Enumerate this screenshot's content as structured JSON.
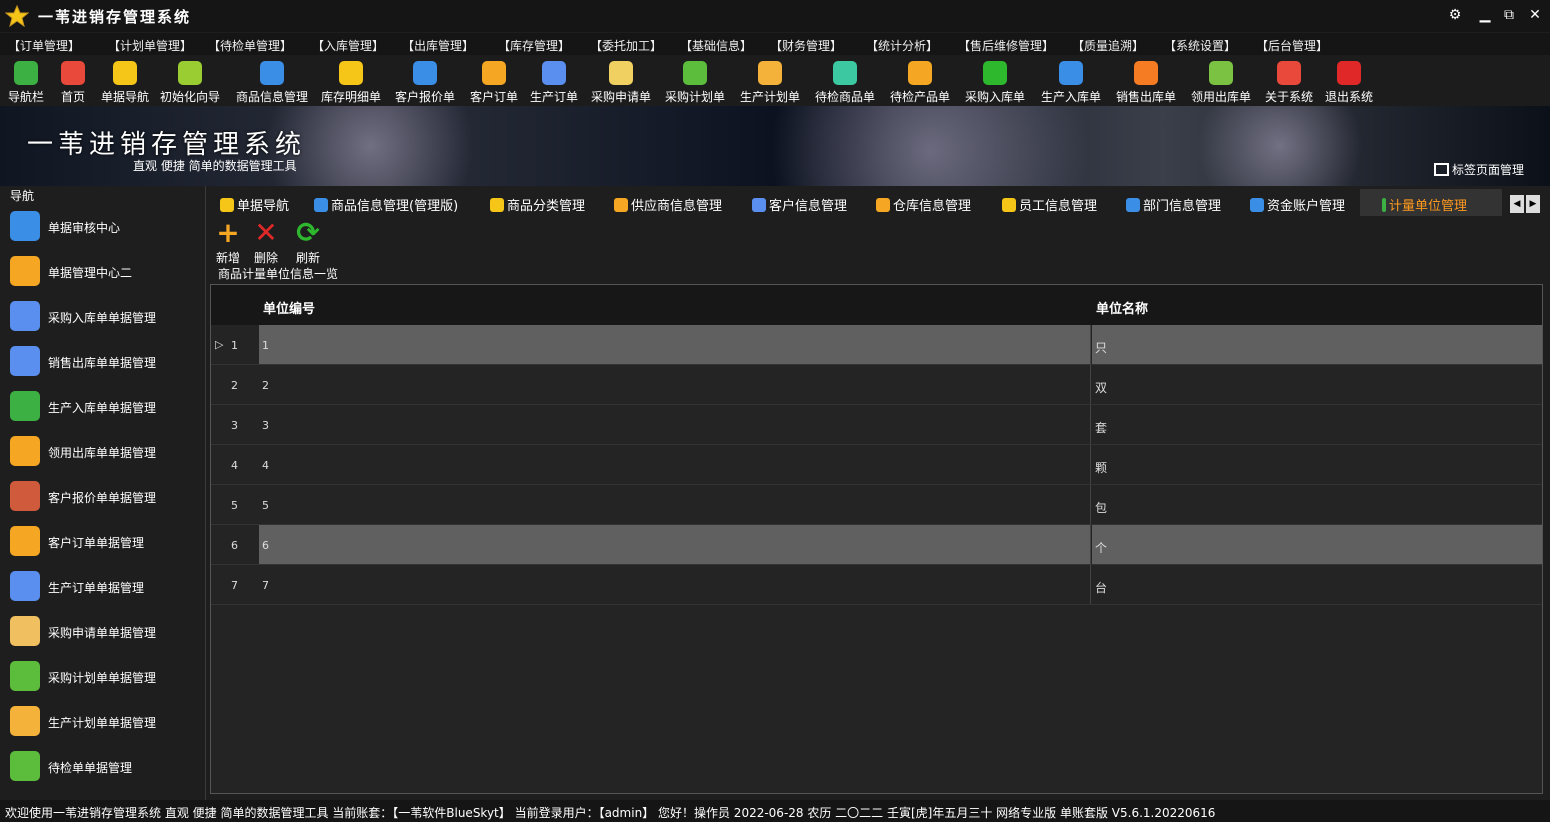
{
  "app": {
    "title": "一苇进销存管理系统"
  },
  "menu": [
    "【订单管理】",
    "【计划单管理】",
    "【待检单管理】",
    "【入库管理】",
    "【出库管理】",
    "【库存管理】",
    "【委托加工】",
    "【基础信息】",
    "【财务管理】",
    "【统计分析】",
    "【售后维修管理】",
    "【质量追溯】",
    "【系统设置】",
    "【后台管理】"
  ],
  "toolbar": [
    {
      "label": "导航栏",
      "icon": "menu-icon",
      "color": "#3cb043"
    },
    {
      "label": "首页",
      "icon": "home-icon",
      "color": "#e8493a"
    },
    {
      "label": "单据导航",
      "icon": "pin-icon",
      "color": "#f5c518"
    },
    {
      "label": "初始化向导",
      "icon": "wand-icon",
      "color": "#9acd32"
    },
    {
      "label": "商品信息管理",
      "icon": "cubes-icon",
      "color": "#3a8ee6"
    },
    {
      "label": "库存明细单",
      "icon": "warning-icon",
      "color": "#f5c518"
    },
    {
      "label": "客户报价单",
      "icon": "tag-icon",
      "color": "#3a8ee6"
    },
    {
      "label": "客户订单",
      "icon": "doc-icon",
      "color": "#f5a623"
    },
    {
      "label": "生产订单",
      "icon": "doc-icon",
      "color": "#5a8ff0"
    },
    {
      "label": "采购申请单",
      "icon": "notepad-icon",
      "color": "#f0d060"
    },
    {
      "label": "采购计划单",
      "icon": "chat-icon",
      "color": "#5cbc3c"
    },
    {
      "label": "生产计划单",
      "icon": "chat-icon",
      "color": "#f5b23a"
    },
    {
      "label": "待检商品单",
      "icon": "flask-icon",
      "color": "#3cc8a0"
    },
    {
      "label": "待检产品单",
      "icon": "beaker-icon",
      "color": "#f5a623"
    },
    {
      "label": "采购入库单",
      "icon": "plus-circle-icon",
      "color": "#2eb82e"
    },
    {
      "label": "生产入库单",
      "icon": "trolley-icon",
      "color": "#3a8ee6"
    },
    {
      "label": "销售出库单",
      "icon": "export-icon",
      "color": "#f57c23"
    },
    {
      "label": "领用出库单",
      "icon": "download-icon",
      "color": "#7cc242"
    },
    {
      "label": "关于系统",
      "icon": "house-icon",
      "color": "#e8493a"
    },
    {
      "label": "退出系统",
      "icon": "exit-icon",
      "color": "#e02828"
    }
  ],
  "banner": {
    "title": "一苇进销存管理系统",
    "subtitle": "直观  便捷  简单的数据管理工具",
    "tab_manager": "标签页面管理"
  },
  "sidebar": {
    "title": "导航",
    "items": [
      {
        "label": "单据审核中心",
        "icon": "grid-icon",
        "color": "#3a8ee6"
      },
      {
        "label": "单据管理中心二",
        "icon": "grid-diamond-icon",
        "color": "#f5a623"
      },
      {
        "label": "采购入库单单据管理",
        "icon": "arrow-left-icon",
        "color": "#5a8ff0"
      },
      {
        "label": "销售出库单单据管理",
        "icon": "arrow-right-icon",
        "color": "#5a8ff0"
      },
      {
        "label": "生产入库单单据管理",
        "icon": "box-icon",
        "color": "#3cb043"
      },
      {
        "label": "领用出库单单据管理",
        "icon": "building-icon",
        "color": "#f5a623"
      },
      {
        "label": "客户报价单单据管理",
        "icon": "books-icon",
        "color": "#d05a3c"
      },
      {
        "label": "客户订单单据管理",
        "icon": "doc-icon",
        "color": "#f5a623"
      },
      {
        "label": "生产订单单据管理",
        "icon": "doc-icon",
        "color": "#5a8ff0"
      },
      {
        "label": "采购申请单单据管理",
        "icon": "envelope-icon",
        "color": "#f0c060"
      },
      {
        "label": "采购计划单单据管理",
        "icon": "chat-icon",
        "color": "#5cbc3c"
      },
      {
        "label": "生产计划单单据管理",
        "icon": "chat-icon",
        "color": "#f5b23a"
      },
      {
        "label": "待检单单据管理",
        "icon": "clipboard-icon",
        "color": "#5cbc3c"
      }
    ]
  },
  "tabs": [
    {
      "label": "单据导航",
      "icon": "pin-icon",
      "color": "#f5c518",
      "active": false
    },
    {
      "label": "商品信息管理(管理版)",
      "icon": "cubes-icon",
      "color": "#3a8ee6",
      "active": false
    },
    {
      "label": "商品分类管理",
      "icon": "tag-icon",
      "color": "#f5c518",
      "active": false
    },
    {
      "label": "供应商信息管理",
      "icon": "contact-icon",
      "color": "#f5a623",
      "active": false
    },
    {
      "label": "客户信息管理",
      "icon": "user-icon",
      "color": "#5a8ff0",
      "active": false
    },
    {
      "label": "仓库信息管理",
      "icon": "boxes-icon",
      "color": "#f5a623",
      "active": false
    },
    {
      "label": "员工信息管理",
      "icon": "people-icon",
      "color": "#f5c518",
      "active": false
    },
    {
      "label": "部门信息管理",
      "icon": "group-icon",
      "color": "#3a8ee6",
      "active": false
    },
    {
      "label": "资金账户管理",
      "icon": "coin-icon",
      "color": "#3a8ee6",
      "active": false
    },
    {
      "label": "计量单位管理",
      "icon": "ruler-icon",
      "color": "#3cb043",
      "active": true
    }
  ],
  "actions": {
    "add": "新增",
    "delete": "删除",
    "refresh": "刷新"
  },
  "list": {
    "title": "商品计量单位信息一览",
    "columns": [
      "单位编号",
      "单位名称"
    ],
    "rows": [
      {
        "n": "1",
        "code": "1",
        "name": "只",
        "selected": true,
        "current": true
      },
      {
        "n": "2",
        "code": "2",
        "name": "双",
        "selected": false,
        "current": false
      },
      {
        "n": "3",
        "code": "3",
        "name": "套",
        "selected": false,
        "current": false
      },
      {
        "n": "4",
        "code": "4",
        "name": "颗",
        "selected": false,
        "current": false
      },
      {
        "n": "5",
        "code": "5",
        "name": "包",
        "selected": false,
        "current": false
      },
      {
        "n": "6",
        "code": "6",
        "name": "个",
        "selected": true,
        "current": false
      },
      {
        "n": "7",
        "code": "7",
        "name": "台",
        "selected": false,
        "current": false
      }
    ]
  },
  "status": "欢迎使用一苇进销存管理系统    直观 便捷 简单的数据管理工具    当前账套：【一苇软件BlueSkyt】    当前登录用户：【admin】 您好！操作员   2022-06-28   农历 二〇二二 壬寅[虎]年五月三十    网络专业版    单账套版   V5.6.1.20220616"
}
